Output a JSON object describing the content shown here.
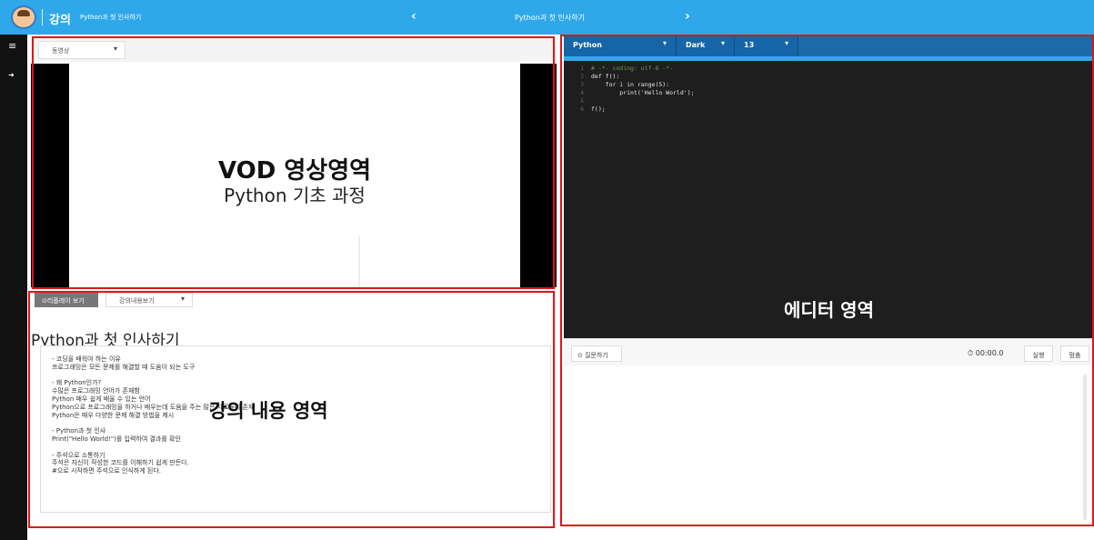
{
  "topbar": {
    "brand": "강의",
    "course": "Python과 첫 인사하기",
    "title": "Python과 첫 인사하기",
    "prev_icon": "chevron-left-icon",
    "next_icon": "chevron-right-icon",
    "prev_glyph": "‹",
    "next_glyph": "›",
    "color": "#2fa8ea"
  },
  "sidebar": {
    "menu_icon": "hamburger-menu-icon",
    "exit_icon": "exit-icon",
    "menu_glyph": "≡",
    "exit_glyph": "➜"
  },
  "vod": {
    "select_value": "동영상",
    "title": "VOD 영상영역",
    "subtitle": "Python 기초 과정"
  },
  "lecture": {
    "replay_label": "⊙리플레이 보기",
    "select_value": "강의내용보기",
    "title": "Python과 첫 인사하기",
    "overlay": "강의 내용 영역",
    "lines": [
      "- 코딩을 배워야 하는 이유",
      "프로그래밍은 모든 문제를 해결할 때 도움이 되는 도구",
      "",
      "- 왜 Python인가?",
      "수많은 프로그래밍 언어가 존재함",
      "Python 매우 쉽게 배울 수 있는 언어",
      "Python으로 프로그래밍을 하거나 배우는데 도움을 주는 많은 자료들이 존재",
      "Python은 매우 다양한 문제 해결 방법을 제시",
      "",
      "- Python과 첫 인사",
      "Print(\"Hello World!\")를 입력하여 결과를 확인",
      "",
      "- 주석으로 소통하기",
      "주석은 자신이 작성한 코드를 이해하기 쉽게 만든다.",
      "#으로 시작하면 주석으로 인식하게 된다."
    ]
  },
  "editor": {
    "language": "Python",
    "theme": "Dark",
    "font_size": "13",
    "overlay": "에디터 영역",
    "line_numbers": [
      "1",
      "2",
      "3",
      "4",
      "5",
      "6"
    ],
    "code": [
      "# -*- coding: utf-8 -*-",
      "def f():",
      "    for i in range(5):",
      "        print('Hello World');",
      "",
      "f();"
    ],
    "ask_label": "⊙ 질문하기",
    "timer": "⏱ 00:00.0",
    "run_label": "실행",
    "stop_label": "멈춤"
  }
}
